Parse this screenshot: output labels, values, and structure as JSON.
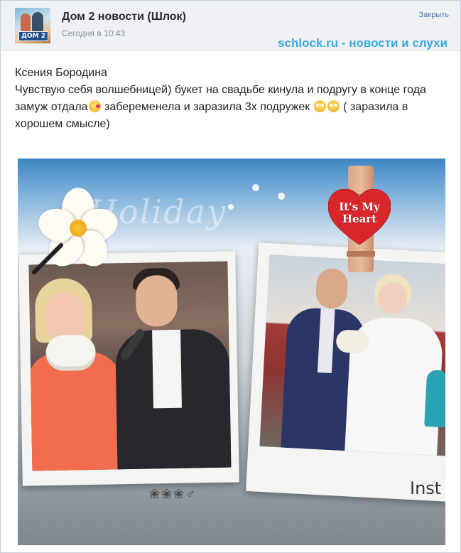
{
  "header": {
    "group_name": "Дом 2 новости (Шлок)",
    "timestamp": "Сегодня в 10:43",
    "close_label": "Закрыть",
    "watermark": "schlock.ru - новости и слухи",
    "avatar_logo": "ДОМ 2"
  },
  "post": {
    "author_line": "Ксения Бородина",
    "line1": "Чувствую себя волшебницей) букет на свадьбе кинула и подругу в конце года замуж отдала",
    "line2": " забеременела и заразила 3х подружек ",
    "line3": " ( заразила в хорошем смысле)",
    "emoji_1": "kiss-emoji",
    "emoji_2": "flushed-emoji"
  },
  "photo": {
    "heart_text_1": "It's My",
    "heart_text_2": "Heart",
    "stamps": "❀❀❀♂",
    "corner_text": "Inst",
    "colors": {
      "heart": "#d8262b",
      "sky": "#3c86c4",
      "dress_left": "#f26d4d",
      "suit_right": "#2b3566"
    }
  }
}
